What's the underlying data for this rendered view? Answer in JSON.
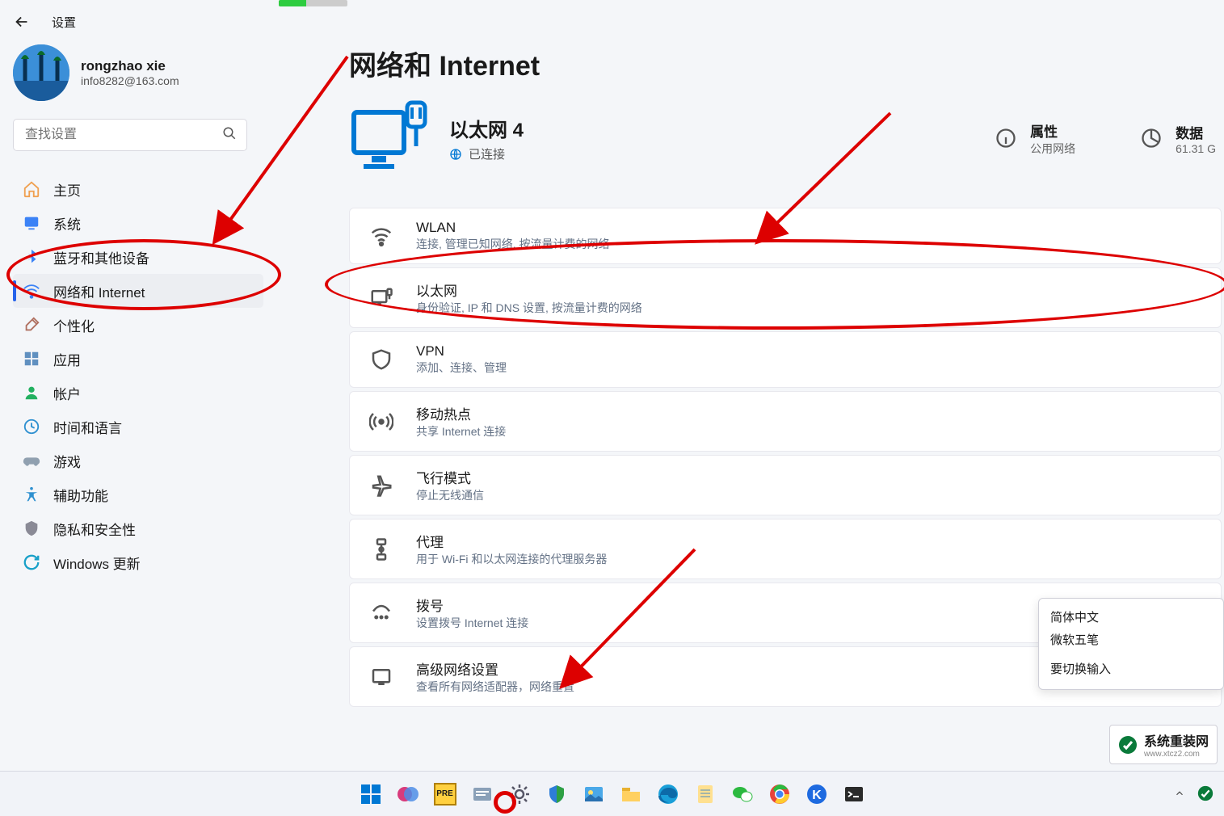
{
  "app_title": "设置",
  "account": {
    "name": "rongzhao xie",
    "email": "info8282@163.com"
  },
  "search": {
    "placeholder": "查找设置"
  },
  "nav": [
    {
      "label": "主页",
      "icon": "home",
      "color": "#f0a050"
    },
    {
      "label": "系统",
      "icon": "system",
      "color": "#3b82f6"
    },
    {
      "label": "蓝牙和其他设备",
      "icon": "bluetooth",
      "color": "#3b82f6"
    },
    {
      "label": "网络和 Internet",
      "icon": "wifi",
      "color": "#3b82f6",
      "active": true
    },
    {
      "label": "个性化",
      "icon": "brush",
      "color": "#b07060"
    },
    {
      "label": "应用",
      "icon": "apps",
      "color": "#6090c0"
    },
    {
      "label": "帐户",
      "icon": "account",
      "color": "#22b060"
    },
    {
      "label": "时间和语言",
      "icon": "time",
      "color": "#2e90d0"
    },
    {
      "label": "游戏",
      "icon": "game",
      "color": "#90a0b0"
    },
    {
      "label": "辅助功能",
      "icon": "accessibility",
      "color": "#2e90d0"
    },
    {
      "label": "隐私和安全性",
      "icon": "privacy",
      "color": "#8a8a96"
    },
    {
      "label": "Windows 更新",
      "icon": "update",
      "color": "#18a0c8"
    }
  ],
  "page_title": "网络和 Internet",
  "connection": {
    "name": "以太网 4",
    "state": "已连接"
  },
  "tiles": {
    "props_title": "属性",
    "props_sub": "公用网络",
    "data_title": "数据",
    "data_sub": "61.31 G"
  },
  "cards": [
    {
      "key": "wlan",
      "title": "WLAN",
      "sub": "连接, 管理已知网络, 按流量计费的网络"
    },
    {
      "key": "ethernet",
      "title": "以太网",
      "sub": "身份验证, IP 和 DNS 设置, 按流量计费的网络"
    },
    {
      "key": "vpn",
      "title": "VPN",
      "sub": "添加、连接、管理"
    },
    {
      "key": "hotspot",
      "title": "移动热点",
      "sub": "共享 Internet 连接"
    },
    {
      "key": "airplane",
      "title": "飞行模式",
      "sub": "停止无线通信"
    },
    {
      "key": "proxy",
      "title": "代理",
      "sub": "用于 Wi-Fi 和以太网连接的代理服务器"
    },
    {
      "key": "dialup",
      "title": "拨号",
      "sub": "设置拨号 Internet 连接"
    },
    {
      "key": "advanced",
      "title": "高级网络设置",
      "sub": "查看所有网络适配器，网络重置"
    }
  ],
  "ime": {
    "line1": "简体中文",
    "line2": "微软五笔",
    "line3": "要切换输入"
  },
  "watermark": {
    "text": "系统重装网",
    "url": "www.xtcz2.com"
  }
}
